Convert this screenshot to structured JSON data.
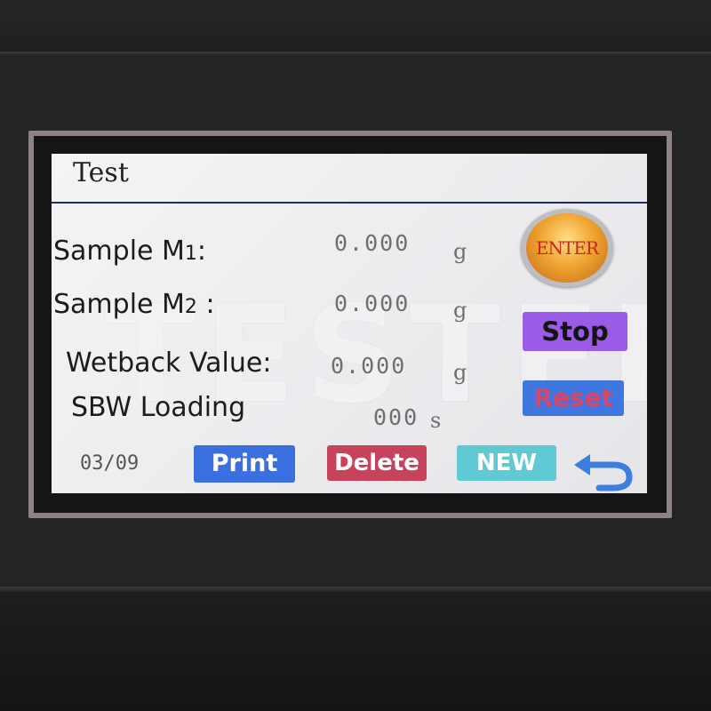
{
  "screen": {
    "title": "Test",
    "watermark": "TESTER"
  },
  "fields": [
    {
      "label": "Sample M",
      "sub": "1",
      "colon": ":",
      "value": "0.000",
      "unit": "g"
    },
    {
      "label": "Sample M",
      "sub": "2",
      "colon": ":",
      "value": "0.000",
      "unit": "g"
    },
    {
      "label": "Wetback Value:",
      "value": "0.000",
      "unit": "g"
    },
    {
      "label": "SBW Loading",
      "value": "000",
      "unit": "s"
    }
  ],
  "buttons": {
    "enter": "ENTER",
    "stop": "Stop",
    "reset": "Reset",
    "print": "Print",
    "delete": "Delete",
    "new": "NEW"
  },
  "footer": {
    "date": "03/09",
    "back_icon": "back-arrow-icon"
  },
  "colors": {
    "print": "#3b6fe0",
    "delete": "#c7435c",
    "new": "#5fc9d4",
    "stop": "#9a5ce6",
    "reset": "#3f76e0",
    "reset_text": "#d8466a",
    "title_rule": "#1d2f6b"
  }
}
